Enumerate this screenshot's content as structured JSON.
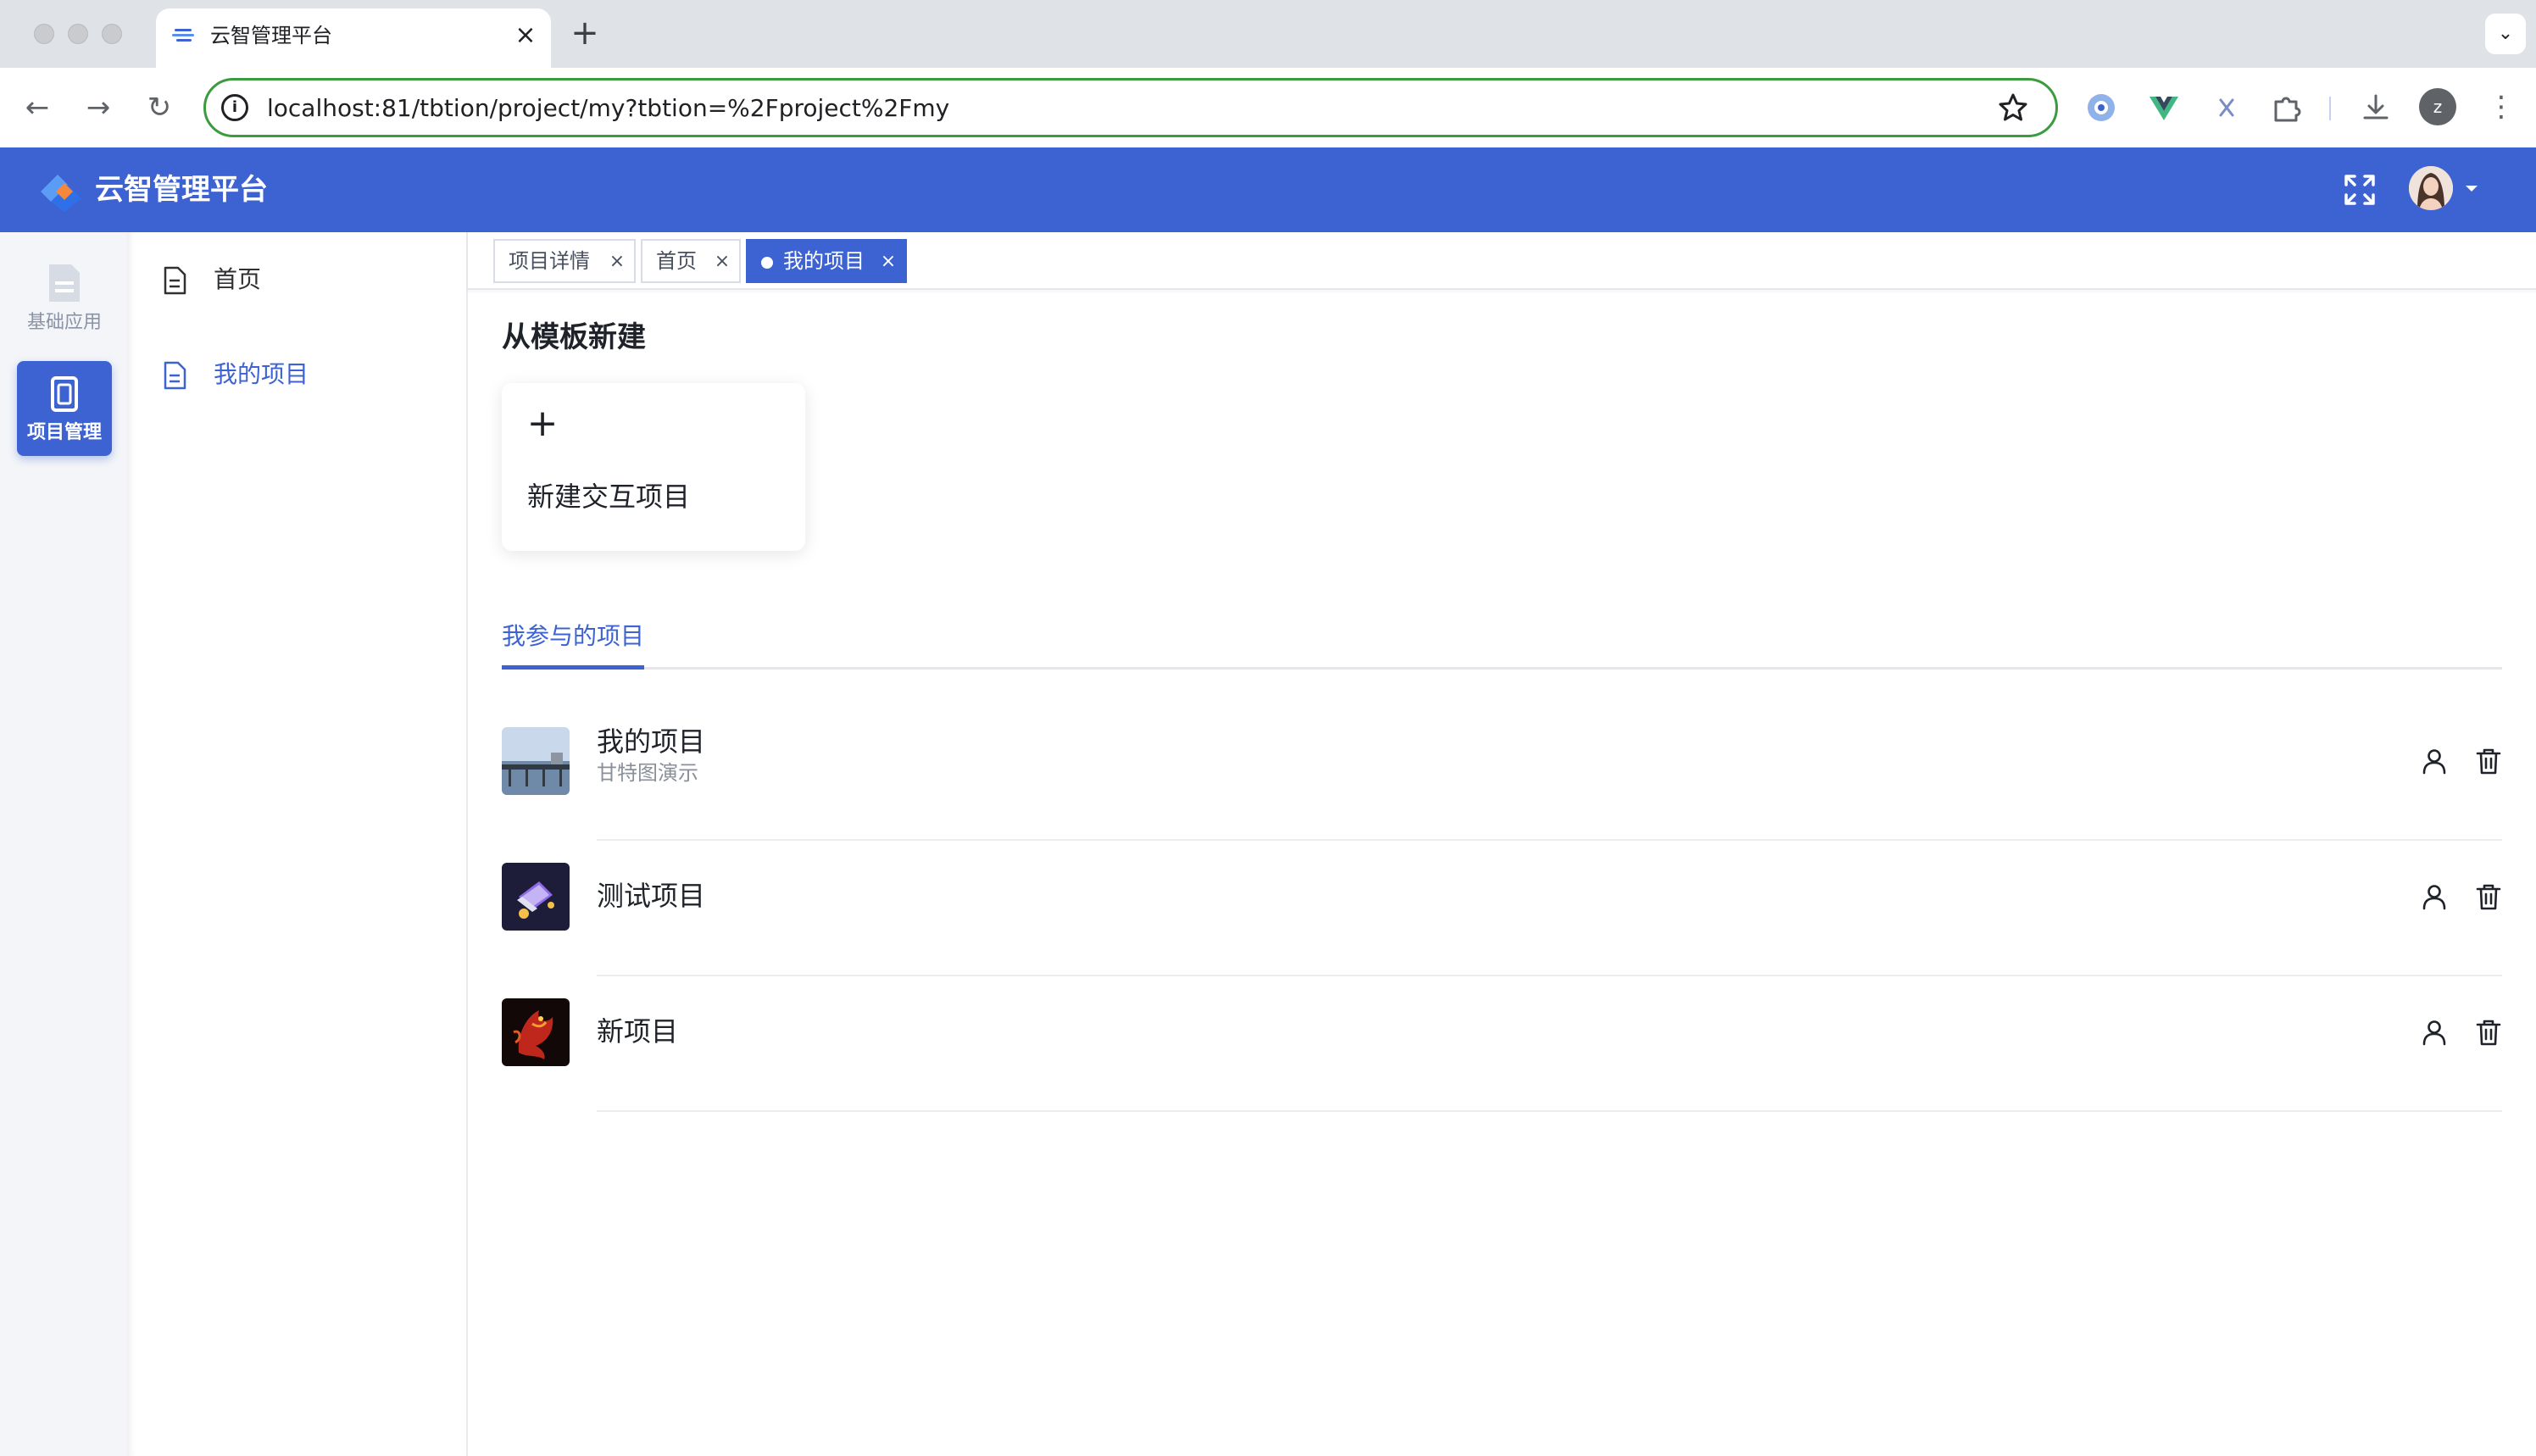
{
  "browser": {
    "tab_title": "云智管理平台",
    "tab_close": "×",
    "new_tab": "+",
    "tab_menu": "⌄",
    "url": "localhost:81/tbtion/project/my?tbtion=%2Fproject%2Fmy",
    "site_info": "i",
    "back": "←",
    "forward": "→",
    "reload": "↻",
    "profile_initial": "z",
    "menu": "⋮"
  },
  "header": {
    "title": "云智管理平台",
    "accent": "#3d63d2"
  },
  "rail": {
    "items": [
      {
        "label": "基础应用",
        "icon": "document-icon",
        "active": false
      },
      {
        "label": "项目管理",
        "icon": "project-icon",
        "active": true
      }
    ]
  },
  "menu": {
    "items": [
      {
        "label": "首页",
        "icon": "file-icon",
        "active": false
      },
      {
        "label": "我的项目",
        "icon": "file-icon",
        "active": true
      }
    ]
  },
  "tags": [
    {
      "label": "项目详情",
      "close": "×",
      "active": false
    },
    {
      "label": "首页",
      "close": "×",
      "active": false
    },
    {
      "label": "我的项目",
      "close": "×",
      "active": true
    }
  ],
  "template_section": {
    "title": "从模板新建",
    "card": {
      "plus": "+",
      "label": "新建交互项目"
    }
  },
  "projects_tab": {
    "label": "我参与的项目"
  },
  "projects": [
    {
      "name": "我的项目",
      "desc": "甘特图演示",
      "thumb": "bridge-photo"
    },
    {
      "name": "测试项目",
      "desc": "",
      "thumb": "laptop-illustration"
    },
    {
      "name": "新项目",
      "desc": "",
      "thumb": "dragon-art"
    }
  ]
}
